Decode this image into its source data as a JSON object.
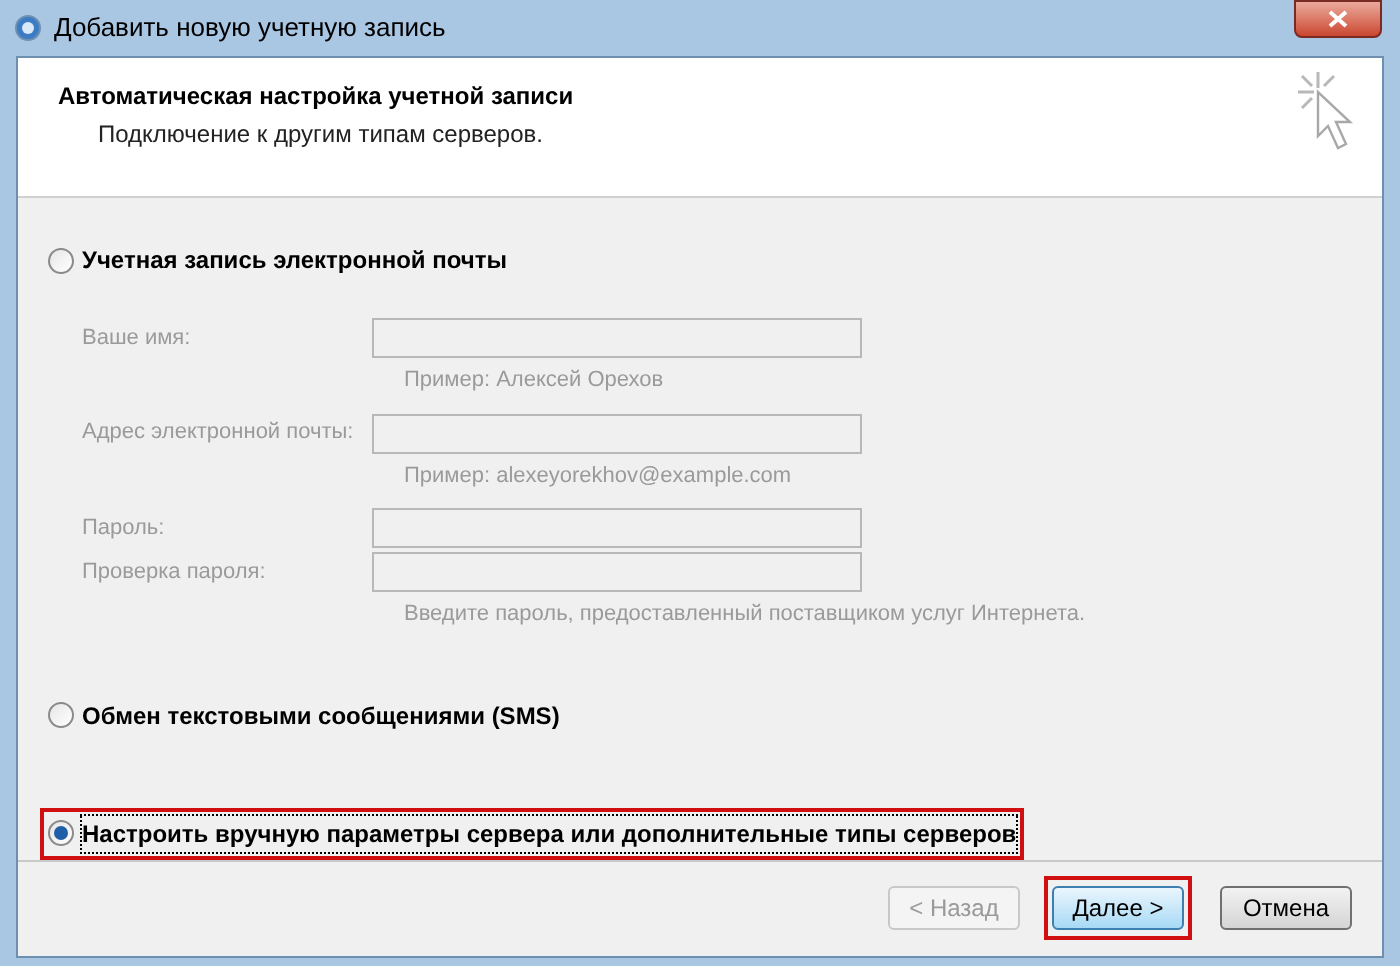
{
  "window": {
    "title": "Добавить новую учетную запись"
  },
  "header": {
    "title": "Автоматическая настройка учетной записи",
    "subtitle": "Подключение к другим типам серверов."
  },
  "options": [
    {
      "label": "Учетная запись электронной почты",
      "selected": false,
      "highlighted": false,
      "fields": [
        {
          "label": "Ваше имя:",
          "disabled": true,
          "hint": "Пример: Алексей Орехов"
        },
        {
          "label": "Адрес электронной почты:",
          "disabled": true,
          "hint": "Пример: alexeyorekhov@example.com"
        },
        {
          "label": "Пароль:",
          "disabled": true
        },
        {
          "label": "Проверка пароля:",
          "disabled": true,
          "hint": "Введите пароль, предоставленный поставщиком услуг Интернета."
        }
      ]
    },
    {
      "label": "Обмен текстовыми сообщениями (SMS)",
      "selected": false,
      "highlighted": false
    },
    {
      "label": "Настроить вручную параметры сервера или дополнительные типы серверов",
      "selected": true,
      "highlighted": true
    }
  ],
  "buttons": [
    {
      "label": "< Назад",
      "disabled": true,
      "highlighted": false,
      "default": false
    },
    {
      "label": "Далее >",
      "disabled": false,
      "highlighted": true,
      "default": true
    },
    {
      "label": "Отмена",
      "disabled": false,
      "highlighted": false,
      "default": false
    }
  ]
}
